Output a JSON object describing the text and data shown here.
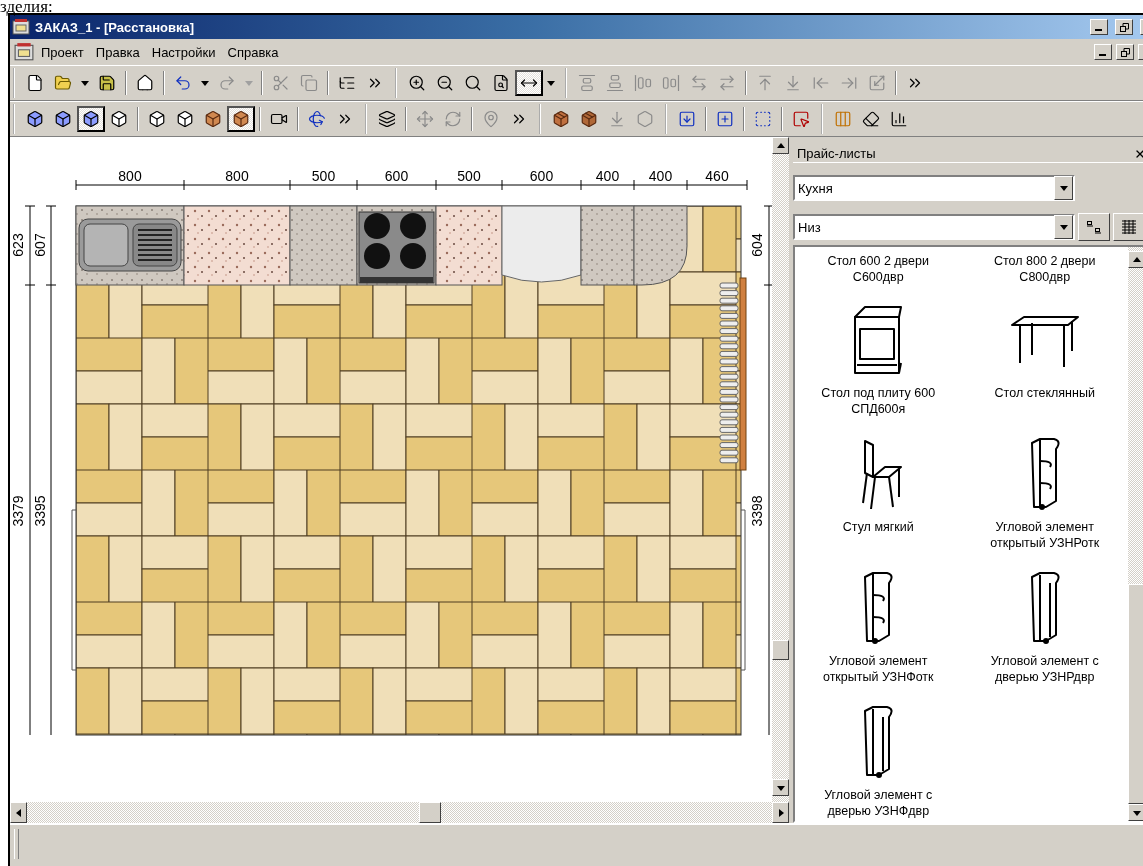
{
  "page_fragment": "зделия:",
  "window": {
    "title": "ЗАКАЗ_1 - [Расстановка]"
  },
  "menu": [
    "Проект",
    "Правка",
    "Настройки",
    "Справка"
  ],
  "toolbars": [
    {
      "bands": [
        [
          [
            {
              "kind": "new",
              "pressed": false,
              "disabled": false
            },
            {
              "kind": "open",
              "pressed": false,
              "disabled": false
            },
            {
              "kind": "dropdown",
              "pressed": false,
              "disabled": false
            },
            {
              "kind": "save",
              "pressed": false,
              "disabled": false
            }
          ],
          [
            {
              "kind": "home",
              "pressed": false,
              "disabled": false
            }
          ],
          [
            {
              "kind": "undo",
              "pressed": false,
              "disabled": false
            },
            {
              "kind": "dropdown",
              "pressed": false,
              "disabled": false
            },
            {
              "kind": "redo",
              "pressed": false,
              "disabled": true
            },
            {
              "kind": "dropdown",
              "pressed": false,
              "disabled": true
            }
          ],
          [
            {
              "kind": "cut",
              "pressed": false,
              "disabled": true
            },
            {
              "kind": "copy",
              "pressed": false,
              "disabled": true
            }
          ],
          [
            {
              "kind": "tree",
              "pressed": false,
              "disabled": false
            },
            {
              "kind": "more",
              "pressed": false,
              "disabled": false
            }
          ]
        ],
        [
          [
            {
              "kind": "zoom-in",
              "pressed": false,
              "disabled": false
            },
            {
              "kind": "zoom-out",
              "pressed": false,
              "disabled": false
            },
            {
              "kind": "zoom-fit",
              "pressed": false,
              "disabled": false
            },
            {
              "kind": "zoom-page",
              "pressed": false,
              "disabled": false
            },
            {
              "kind": "fit-width",
              "pressed": true,
              "disabled": false
            },
            {
              "kind": "dropdown",
              "pressed": false,
              "disabled": false
            }
          ]
        ],
        [
          [
            {
              "kind": "align-top",
              "pressed": false,
              "disabled": true
            },
            {
              "kind": "align-bottom",
              "pressed": false,
              "disabled": true
            },
            {
              "kind": "align-left",
              "pressed": false,
              "disabled": true
            },
            {
              "kind": "align-right",
              "pressed": false,
              "disabled": true
            },
            {
              "kind": "stack-left",
              "pressed": false,
              "disabled": true
            },
            {
              "kind": "stack-right",
              "pressed": false,
              "disabled": true
            }
          ],
          [
            {
              "kind": "to-top",
              "pressed": false,
              "disabled": true
            },
            {
              "kind": "to-bottom",
              "pressed": false,
              "disabled": true
            },
            {
              "kind": "to-left",
              "pressed": false,
              "disabled": true
            },
            {
              "kind": "to-right",
              "pressed": false,
              "disabled": true
            },
            {
              "kind": "scale",
              "pressed": false,
              "disabled": true
            }
          ],
          [
            {
              "kind": "more",
              "pressed": false,
              "disabled": false
            }
          ]
        ]
      ]
    },
    {
      "bands": [
        [
          [
            {
              "kind": "cube-shaded",
              "pressed": false,
              "disabled": false
            },
            {
              "kind": "cube-shaded",
              "pressed": false,
              "disabled": false
            },
            {
              "kind": "cube-shaded",
              "pressed": true,
              "disabled": false
            },
            {
              "kind": "cube",
              "pressed": false,
              "disabled": false
            }
          ],
          [
            {
              "kind": "cube",
              "pressed": false,
              "disabled": false
            },
            {
              "kind": "cube",
              "pressed": false,
              "disabled": false
            },
            {
              "kind": "cube-solid",
              "pressed": false,
              "disabled": false
            },
            {
              "kind": "cube-solid",
              "pressed": true,
              "disabled": false
            }
          ],
          [
            {
              "kind": "camera",
              "pressed": false,
              "disabled": false
            }
          ],
          [
            {
              "kind": "rotate-axis",
              "pressed": false,
              "disabled": false
            },
            {
              "kind": "more",
              "pressed": false,
              "disabled": false
            }
          ]
        ],
        [
          [
            {
              "kind": "group",
              "pressed": false,
              "disabled": false
            }
          ],
          [
            {
              "kind": "move",
              "pressed": false,
              "disabled": true
            },
            {
              "kind": "rotate",
              "pressed": false,
              "disabled": true
            }
          ],
          [
            {
              "kind": "pin",
              "pressed": false,
              "disabled": true
            },
            {
              "kind": "more",
              "pressed": false,
              "disabled": false
            }
          ]
        ],
        [
          [
            {
              "kind": "light-box",
              "pressed": false,
              "disabled": false
            },
            {
              "kind": "corner-box",
              "pressed": false,
              "disabled": false
            },
            {
              "kind": "shelf",
              "pressed": false,
              "disabled": true
            },
            {
              "kind": "polygon",
              "pressed": false,
              "disabled": true
            }
          ]
        ],
        [
          [
            {
              "kind": "drop-box",
              "pressed": false,
              "disabled": false
            }
          ],
          [
            {
              "kind": "place-box",
              "pressed": false,
              "disabled": false
            }
          ],
          [
            {
              "kind": "transform-box",
              "pressed": false,
              "disabled": false
            }
          ],
          [
            {
              "kind": "select-box",
              "pressed": false,
              "disabled": false
            }
          ]
        ],
        [
          [
            {
              "kind": "columns",
              "pressed": false,
              "disabled": false
            },
            {
              "kind": "eraser",
              "pressed": false,
              "disabled": false
            },
            {
              "kind": "chart",
              "pressed": false,
              "disabled": false
            }
          ]
        ]
      ]
    }
  ],
  "plan": {
    "top_dimensions": [
      "800",
      "800",
      "500",
      "600",
      "500",
      "600",
      "400",
      "400",
      "460"
    ],
    "left_dimensions": [
      "623",
      "607",
      "3379",
      "3395"
    ],
    "right_dimensions": [
      "604",
      "3398"
    ]
  },
  "panel": {
    "title": "Прайс-листы",
    "category": "Кухня",
    "section": "Низ",
    "items": [
      {
        "label": "Стол 600 2 двери\nС600двр"
      },
      {
        "label": "Стол 800 2 двери\nС800двр"
      },
      {
        "kind": "stove",
        "label": "Стол под плиту 600\nСПД600я"
      },
      {
        "kind": "table",
        "label": "Стол стеклянный"
      },
      {
        "kind": "chair",
        "label": "Стул мягкий"
      },
      {
        "kind": "corner-open",
        "label": "Угловой элемент\nоткрытый УЗНРотк"
      },
      {
        "kind": "corner-open",
        "label": "Угловой элемент\nоткрытый УЗНФотк"
      },
      {
        "kind": "corner-door",
        "label": "Угловой элемент с\nдверью УЗНРдвр"
      },
      {
        "kind": "corner-door",
        "label": "Угловой элемент с\nдверью УЗНФдвр"
      }
    ]
  }
}
